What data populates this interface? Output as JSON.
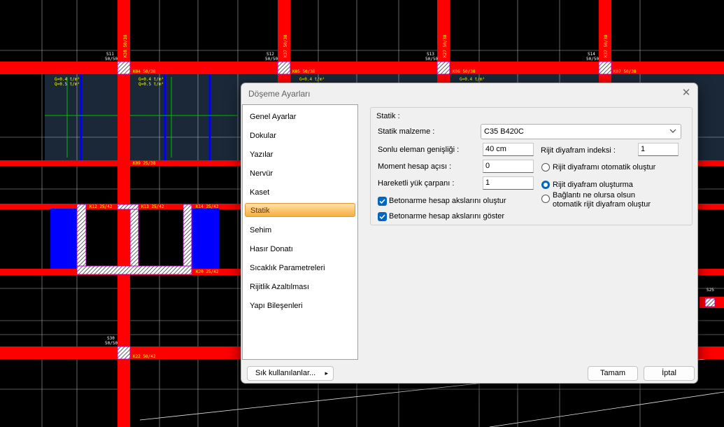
{
  "background": {
    "column_labels": [
      {
        "id": "S11",
        "size": "50/50"
      },
      {
        "id": "S12",
        "size": "50/50"
      },
      {
        "id": "S13",
        "size": "50/50"
      },
      {
        "id": "S14",
        "size": "50/50"
      },
      {
        "id": "S30",
        "size": "50/50"
      },
      {
        "id": "S25",
        "size": ""
      }
    ],
    "beam_labels": [
      "K04 50/38",
      "K05 50/38",
      "K06 50/38",
      "K07 50/38",
      "K09 25/38",
      "K12 25/42",
      "K13 25/42",
      "K14 25/42",
      "K20 25/42",
      "K22 50/42",
      "K38 50/38",
      "K37 50/38",
      "K27 50/38"
    ],
    "load_labels": [
      "G=0.4 t/m²",
      "Q=0.5 t/m²"
    ]
  },
  "dialog": {
    "title": "Döşeme Ayarları",
    "close_symbol": "✕",
    "nav_items": [
      "Genel Ayarlar",
      "Dokular",
      "Yazılar",
      "Nervür",
      "Kaset",
      "Statik",
      "Sehim",
      "Hasır Donatı",
      "Sıcaklık Parametreleri",
      "Rijitlik Azaltılması",
      "Yapı Bileşenleri"
    ],
    "active_nav": "Statik",
    "group_title": "Statik :",
    "material_label": "Statik malzeme :",
    "material_value": "C35 B420C",
    "fields": [
      {
        "label": "Sonlu eleman genişliği :",
        "value": "40 cm"
      },
      {
        "label": "Moment hesap açısı :",
        "value": "0"
      },
      {
        "label": "Hareketli yük çarpanı :",
        "value": "1"
      }
    ],
    "checkboxes": [
      {
        "label": "Betonarme hesap akslarını oluştur",
        "checked": true
      },
      {
        "label": "Betonarme hesap akslarını göster",
        "checked": true
      }
    ],
    "diaphragm_label": "Rijit diyafram indeksi :",
    "diaphragm_value": "1",
    "radios": [
      {
        "label": "Rijit diyaframı otomatik oluştur",
        "selected": false
      },
      {
        "label": "Rijit diyafram oluşturma",
        "selected": true
      },
      {
        "label": "Bağlantı ne olursa olsun",
        "label2": "otomatik rijit diyafram oluştur",
        "selected": false
      }
    ],
    "favorites_label": "Sık kullanılanlar...",
    "favorites_arrow": "▸",
    "ok_label": "Tamam",
    "cancel_label": "İptal"
  },
  "colors": {
    "accent": "#0067c0",
    "beam": "#ff0000",
    "slab_fill": "#1a2838",
    "blue_beam": "#0000ff"
  }
}
